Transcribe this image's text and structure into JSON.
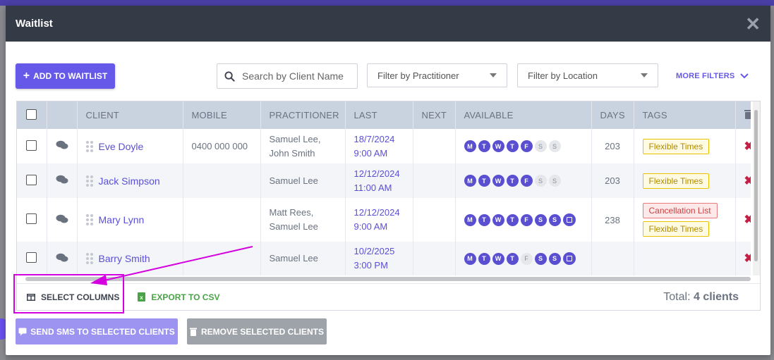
{
  "modal": {
    "title": "Waitlist",
    "close_glyph": "✕"
  },
  "toolbar": {
    "add_label": "ADD TO WAITLIST",
    "search_placeholder": "Search by Client Name",
    "practitioner_placeholder": "Filter by Practitioner",
    "location_placeholder": "Filter by Location",
    "more_filters": "MORE FILTERS"
  },
  "table": {
    "headers": [
      "CLIENT",
      "MOBILE",
      "PRACTITIONER",
      "LAST",
      "NEXT",
      "AVAILABLE",
      "DAYS",
      "TAGS"
    ],
    "rows": [
      {
        "client": "Eve Doyle",
        "mobile": "0400 000 000",
        "practitioner": [
          "Samuel Lee,",
          "John Smith"
        ],
        "last": [
          "18/7/2024",
          "9:00 AM"
        ],
        "next": "",
        "days": "203",
        "tags": [
          "Flexible Times"
        ]
      },
      {
        "client": "Jack Simpson",
        "mobile": "",
        "practitioner": [
          "Samuel Lee"
        ],
        "last": [
          "12/12/2024",
          "11:00 AM"
        ],
        "next": "",
        "days": "203",
        "tags": [
          "Flexible Times"
        ]
      },
      {
        "client": "Mary Lynn",
        "mobile": "",
        "practitioner": [
          "Matt Rees,",
          "Samuel Lee"
        ],
        "last": [
          "12/12/2024",
          "9:00 AM"
        ],
        "next": "",
        "days": "238",
        "tags": [
          "Cancellation List",
          "Flexible Times"
        ]
      },
      {
        "client": "Barry Smith",
        "mobile": "",
        "practitioner": [
          "Samuel Lee"
        ],
        "last": [
          "10/2/2025",
          "3:00 PM"
        ],
        "next": "",
        "days": "",
        "tags": []
      }
    ],
    "day_letters": [
      "M",
      "T",
      "W",
      "T",
      "F",
      "S",
      "S"
    ],
    "delete_glyph": "✖"
  },
  "footer": {
    "select_columns": "SELECT COLUMNS",
    "export_csv": "EXPORT TO CSV",
    "total_prefix": "Total:",
    "total_value": "4 clients"
  },
  "actions": {
    "send_sms": "SEND SMS TO SELECTED CLIENTS",
    "remove_selected": "REMOVE SELECTED CLIENTS"
  },
  "colors": {
    "accent": "#6658e8",
    "header_bg": "#343a46",
    "annotation": "#d400e0"
  }
}
